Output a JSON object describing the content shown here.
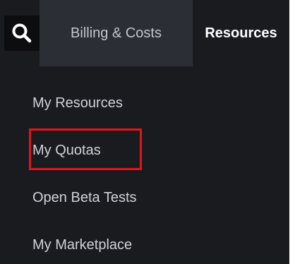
{
  "header": {
    "search_icon": "search-icon",
    "tabs": [
      {
        "label": "Billing & Costs"
      },
      {
        "label": "Resources"
      }
    ]
  },
  "menu": {
    "items": [
      {
        "label": "My Resources"
      },
      {
        "label": "My Quotas"
      },
      {
        "label": "Open Beta Tests"
      },
      {
        "label": "My Marketplace"
      }
    ]
  },
  "colors": {
    "background": "#1a1b1f",
    "active_tab_bg": "#2c2e35",
    "highlight_border": "#e1141f"
  }
}
